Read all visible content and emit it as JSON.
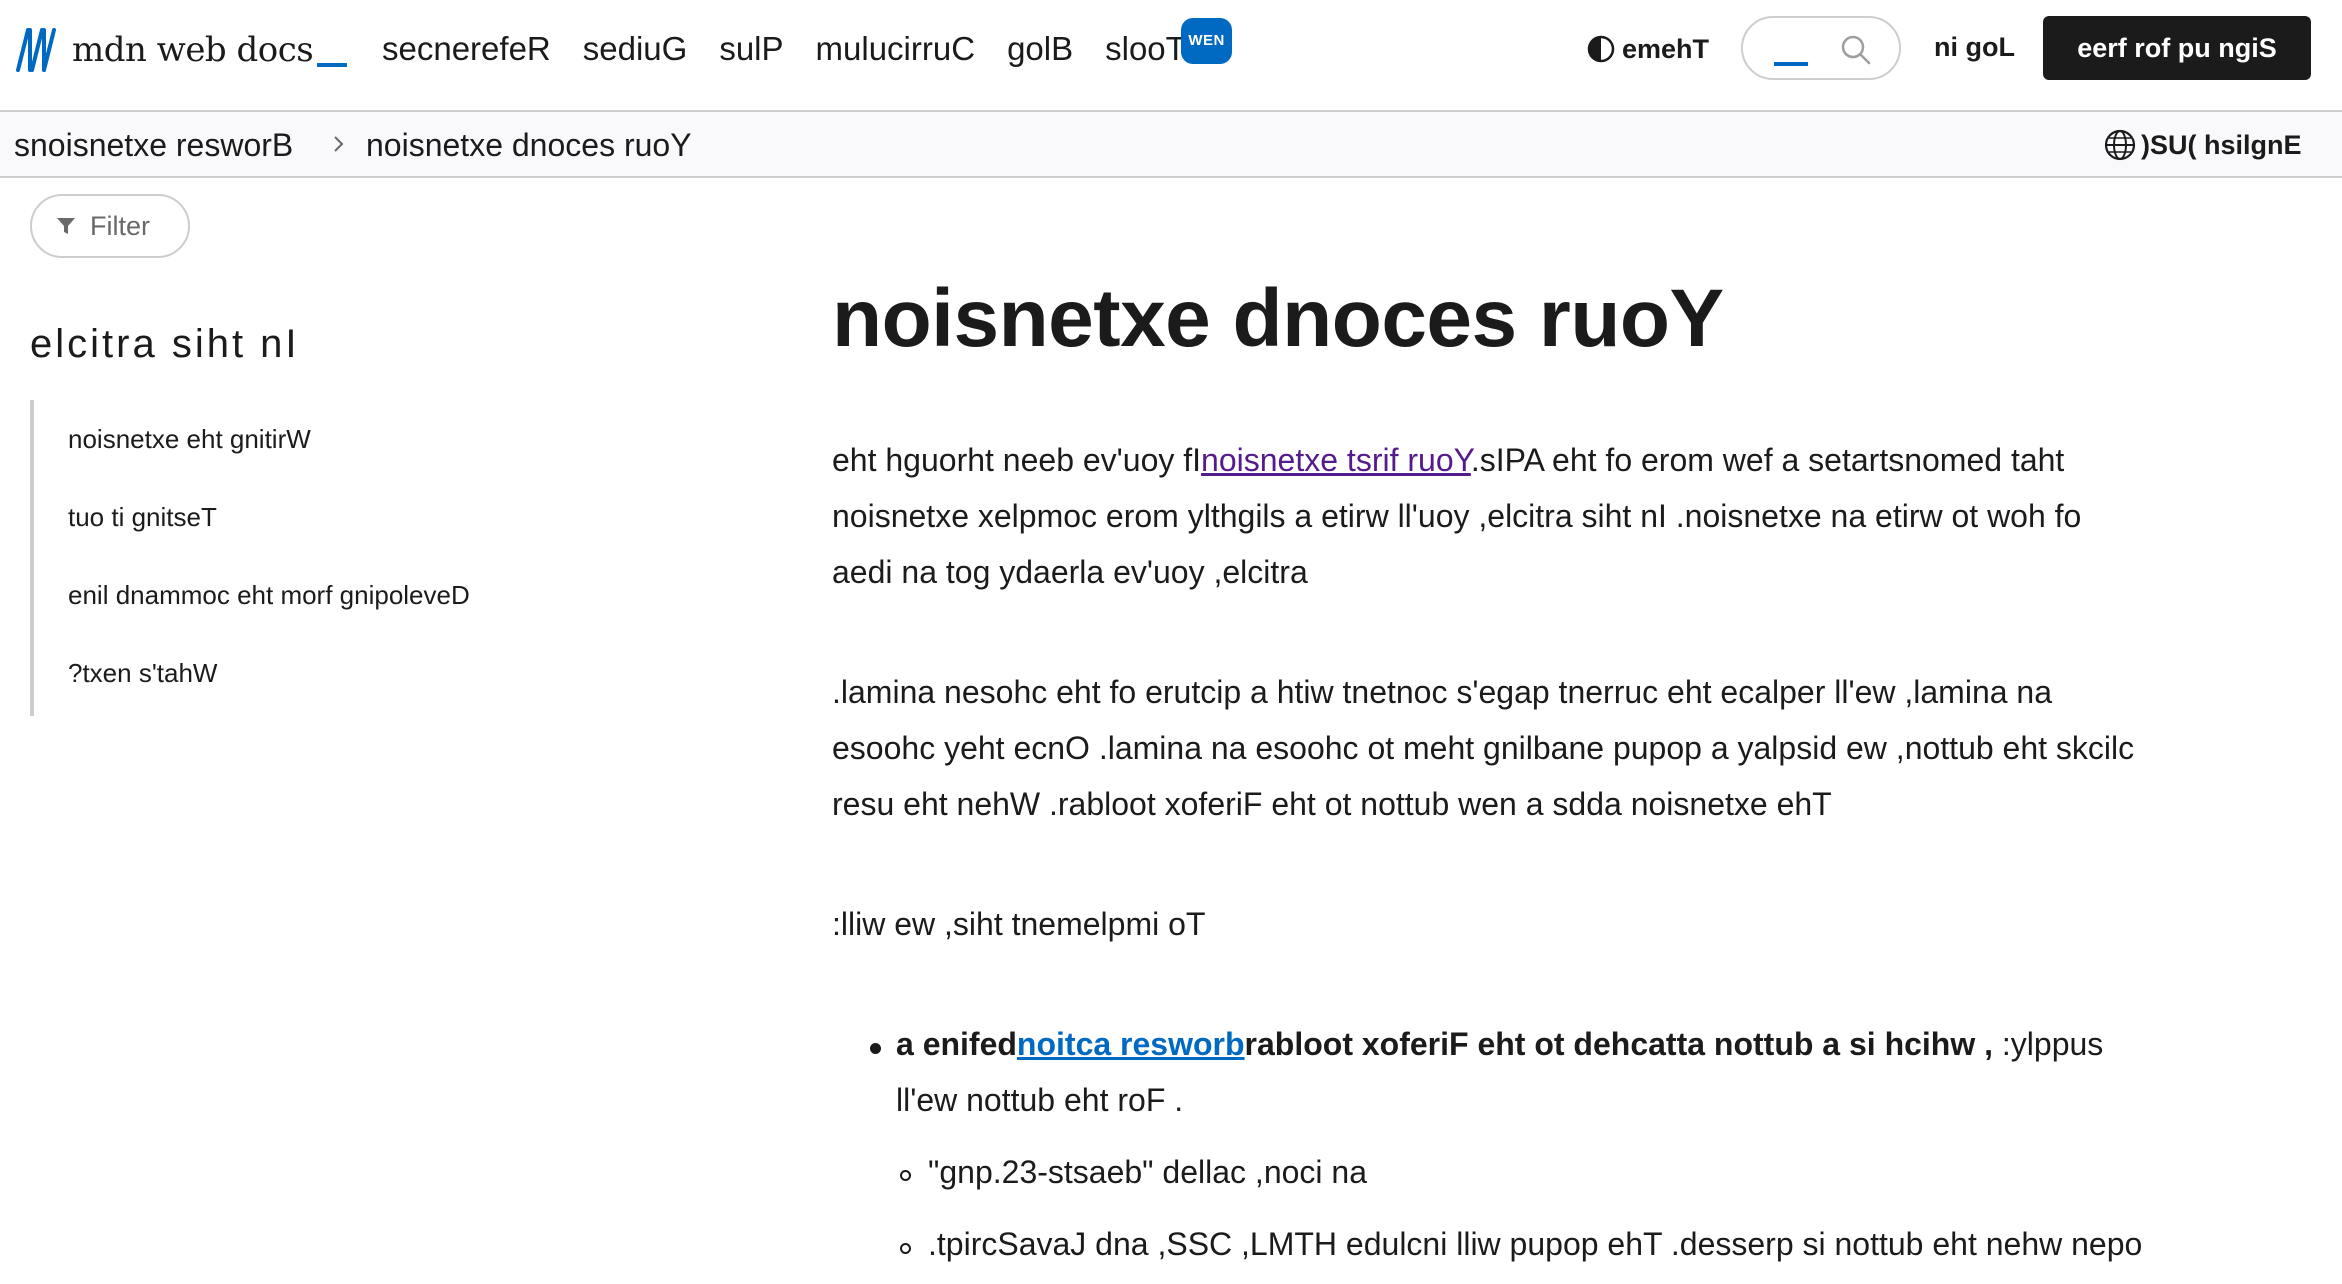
{
  "header": {
    "logo_text": "mdn web docs",
    "nav": [
      {
        "label": "secnerefeR"
      },
      {
        "label": "sediuG"
      },
      {
        "label": "sulP"
      },
      {
        "label": "mulucirruC"
      },
      {
        "label": "golB"
      },
      {
        "label": "slooT",
        "badge": "WEN"
      }
    ],
    "theme_label": "emehT",
    "login_label": "ni goL",
    "signup_label": "eerf rof pu ngiS"
  },
  "breadcrumb": {
    "items": [
      "snoisnetxe resworB",
      "noisnetxe dnoces ruoY"
    ],
    "language": ")SU( hsilgnE"
  },
  "sidebar": {
    "filter_label": "Filter",
    "toc_title": "elcitra siht nI",
    "toc_items": [
      "noisnetxe eht gnitirW",
      "tuo ti gnitseT",
      "enil dnammoc eht morf gnipoleveD",
      "?txen s'tahW"
    ]
  },
  "article": {
    "title": "noisnetxe dnoces ruoY",
    "p1": {
      "line1_before": "eht hguorht neeb ev'uoy fI",
      "line1_link": "noisnetxe tsrif ruoY",
      "line1_after": ".sIPA eht fo erom wef a setartsnomed taht",
      "line2": "noisnetxe xelpmoc erom ylthgils a etirw ll'uoy ,elcitra siht nI .noisnetxe na etirw ot woh fo",
      "line3": "aedi na tog ydaerla ev'uoy ,elcitra"
    },
    "p2": {
      "line1": ".lamina nesohc eht fo erutcip a htiw tnetnoc s'egap tnerruc eht ecalper ll'ew ,lamina na",
      "line2": "esoohc yeht ecnO .lamina na esoohc ot meht gnilbane pupop a yalpsid ew ,nottub eht skcilc",
      "line3": "resu eht nehW .rabloot xoferiF eht ot nottub wen a sdda noisnetxe ehT"
    },
    "p3": ":lliw ew ,siht tnemelpmi oT",
    "list": {
      "item1_bold_before": "a enifed",
      "item1_link": "noitca resworb",
      "item1_bold_after": "rabloot xoferiF eht ot dehcatta nottub a si hcihw ,",
      "item1_rest": " :ylppus",
      "item1_line2": "ll'ew nottub eht roF .",
      "sub1": "\"gnp.23-stsaeb\" dellac ,noci na",
      "sub2": ".tpircSavaJ dna ,SSC ,LMTH edulcni lliw pupop ehT .desserp si nottub eht nehw nepo"
    }
  }
}
